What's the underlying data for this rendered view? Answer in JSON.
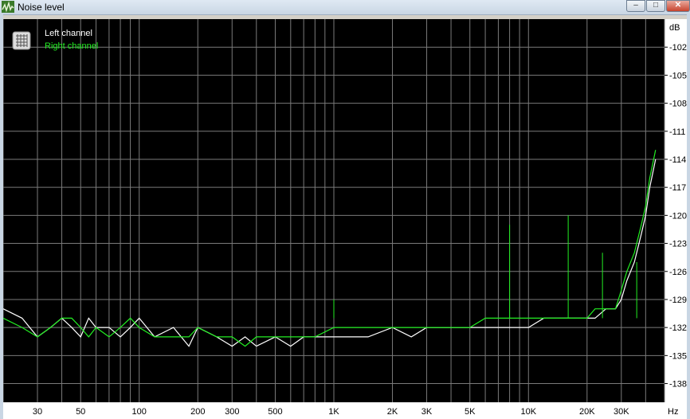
{
  "window": {
    "title": "Noise level",
    "btn_min": "–",
    "btn_max": "□",
    "btn_close": "✕",
    "icon": "waveform-app-icon"
  },
  "legend": {
    "icon": "grid-icon",
    "left_label": "Left channel",
    "right_label": "Right channel"
  },
  "colors": {
    "background": "#000000",
    "grid": "#7a7a7a",
    "left_channel": "#ffffff",
    "right_channel": "#22ee22",
    "axis_panel": "#ffffff"
  },
  "chart_data": {
    "type": "line",
    "xscale": "log",
    "xlim": [
      20,
      50000
    ],
    "ylim": [
      -140,
      -99
    ],
    "yunit": "dB",
    "xunit": "Hz",
    "yticks": [
      -102,
      -105,
      -108,
      -111,
      -114,
      -117,
      -120,
      -123,
      -126,
      -129,
      -132,
      -135,
      -138
    ],
    "xticks": [
      {
        "v": 30,
        "label": "30"
      },
      {
        "v": 50,
        "label": "50"
      },
      {
        "v": 100,
        "label": "100"
      },
      {
        "v": 200,
        "label": "200"
      },
      {
        "v": 300,
        "label": "300"
      },
      {
        "v": 500,
        "label": "500"
      },
      {
        "v": 1000,
        "label": "1K"
      },
      {
        "v": 2000,
        "label": "2K"
      },
      {
        "v": 3000,
        "label": "3K"
      },
      {
        "v": 5000,
        "label": "5K"
      },
      {
        "v": 10000,
        "label": "10K"
      },
      {
        "v": 20000,
        "label": "20K"
      },
      {
        "v": 30000,
        "label": "30K"
      }
    ],
    "series": [
      {
        "name": "Left channel",
        "x": [
          20,
          25,
          30,
          35,
          40,
          45,
          50,
          55,
          60,
          70,
          80,
          90,
          100,
          120,
          150,
          180,
          200,
          250,
          300,
          350,
          400,
          500,
          600,
          700,
          800,
          1000,
          1200,
          1500,
          2000,
          2500,
          3000,
          4000,
          5000,
          6000,
          8000,
          10000,
          12000,
          15000,
          18000,
          20000,
          22000,
          25000,
          28000,
          30000,
          32000,
          35000,
          38000,
          40000,
          42000,
          45000
        ],
        "y": [
          -130,
          -131,
          -133,
          -132,
          -131,
          -132,
          -133,
          -131,
          -132,
          -132,
          -133,
          -132,
          -131,
          -133,
          -132,
          -134,
          -132,
          -133,
          -134,
          -133,
          -134,
          -133,
          -134,
          -133,
          -133,
          -133,
          -133,
          -133,
          -132,
          -133,
          -132,
          -132,
          -132,
          -132,
          -132,
          -132,
          -131,
          -131,
          -131,
          -131,
          -131,
          -130,
          -130,
          -129,
          -127,
          -125,
          -122,
          -120,
          -117,
          -114
        ]
      },
      {
        "name": "Right channel",
        "x": [
          20,
          25,
          30,
          35,
          40,
          45,
          50,
          55,
          60,
          70,
          80,
          90,
          100,
          120,
          150,
          180,
          200,
          250,
          300,
          350,
          400,
          500,
          600,
          700,
          800,
          1000,
          1200,
          1500,
          2000,
          2500,
          3000,
          4000,
          5000,
          6000,
          8000,
          10000,
          12000,
          15000,
          18000,
          20000,
          22000,
          25000,
          28000,
          30000,
          32000,
          35000,
          38000,
          40000,
          42000,
          45000
        ],
        "y": [
          -131,
          -132,
          -133,
          -132,
          -131,
          -131,
          -132,
          -133,
          -132,
          -133,
          -132,
          -131,
          -132,
          -133,
          -133,
          -133,
          -132,
          -133,
          -133,
          -134,
          -133,
          -133,
          -133,
          -133,
          -133,
          -132,
          -132,
          -132,
          -132,
          -132,
          -132,
          -132,
          -132,
          -131,
          -131,
          -131,
          -131,
          -131,
          -131,
          -131,
          -130,
          -130,
          -130,
          -128,
          -126,
          -124,
          -121,
          -119,
          -116,
          -113
        ]
      }
    ],
    "spikes": [
      {
        "x": 1000,
        "y": -129
      },
      {
        "x": 8000,
        "y": -121
      },
      {
        "x": 16000,
        "y": -120
      },
      {
        "x": 24000,
        "y": -124
      },
      {
        "x": 36000,
        "y": -125
      }
    ]
  }
}
